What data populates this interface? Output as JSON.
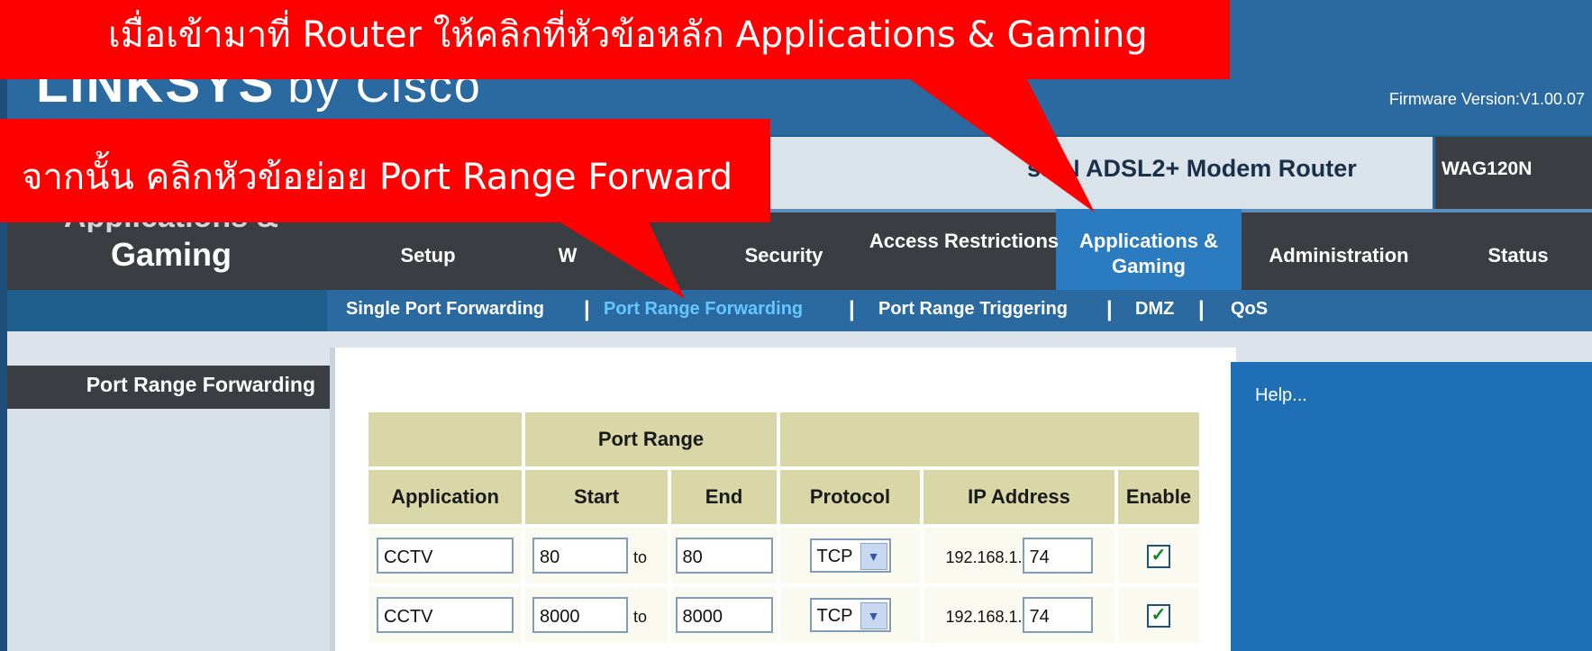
{
  "header": {
    "logo_text": "LINKSYS",
    "logo_suffix": "by Cisco",
    "firmware": "Firmware Version:V1.00.07",
    "product_name": "ss-N ADSL2+ Modem Router",
    "model": "WAG120N"
  },
  "page_section": {
    "line1": "Applications &",
    "line2": "Gaming"
  },
  "nav": {
    "items": [
      {
        "label": "Setup"
      },
      {
        "label": "W"
      },
      {
        "label": "Security"
      },
      {
        "label": "Access Restrictions"
      },
      {
        "label": "Applications & Gaming"
      },
      {
        "label": "Administration"
      },
      {
        "label": "Status"
      }
    ],
    "active": "Applications & Gaming"
  },
  "sub_nav": {
    "items": [
      {
        "label": "Single Port Forwarding"
      },
      {
        "label": "Port Range Forwarding"
      },
      {
        "label": "Port Range Triggering"
      },
      {
        "label": "DMZ"
      },
      {
        "label": "QoS"
      }
    ],
    "separator": "|"
  },
  "left_panel": {
    "label": "Port Range Forwarding"
  },
  "help": {
    "text": "Help..."
  },
  "table": {
    "group_header": "Port Range",
    "headers": [
      "Application",
      "Start",
      "End",
      "Protocol",
      "IP Address",
      "Enable"
    ],
    "to_label": "to",
    "rows": [
      {
        "application": "CCTV",
        "start": "80",
        "end": "80",
        "protocol": "TCP",
        "ip_prefix": "192.168.1.",
        "ip_last": "74",
        "enabled": true
      },
      {
        "application": "CCTV",
        "start": "8000",
        "end": "8000",
        "protocol": "TCP",
        "ip_prefix": "192.168.1.",
        "ip_last": "74",
        "enabled": true
      }
    ]
  },
  "callouts": {
    "top": "เมื่อเข้ามาที่ Router ให้คลิกที่หัวข้อหลัก Applications & Gaming",
    "middle": "จากนั้น คลิกหัวข้อย่อย Port Range Forward"
  },
  "colors": {
    "callout": "#ff0000",
    "header": "#2b6aa0",
    "nav": "#3a3d42",
    "active_tab": "#2b7bc0",
    "active_sub": "#64c8ff"
  }
}
